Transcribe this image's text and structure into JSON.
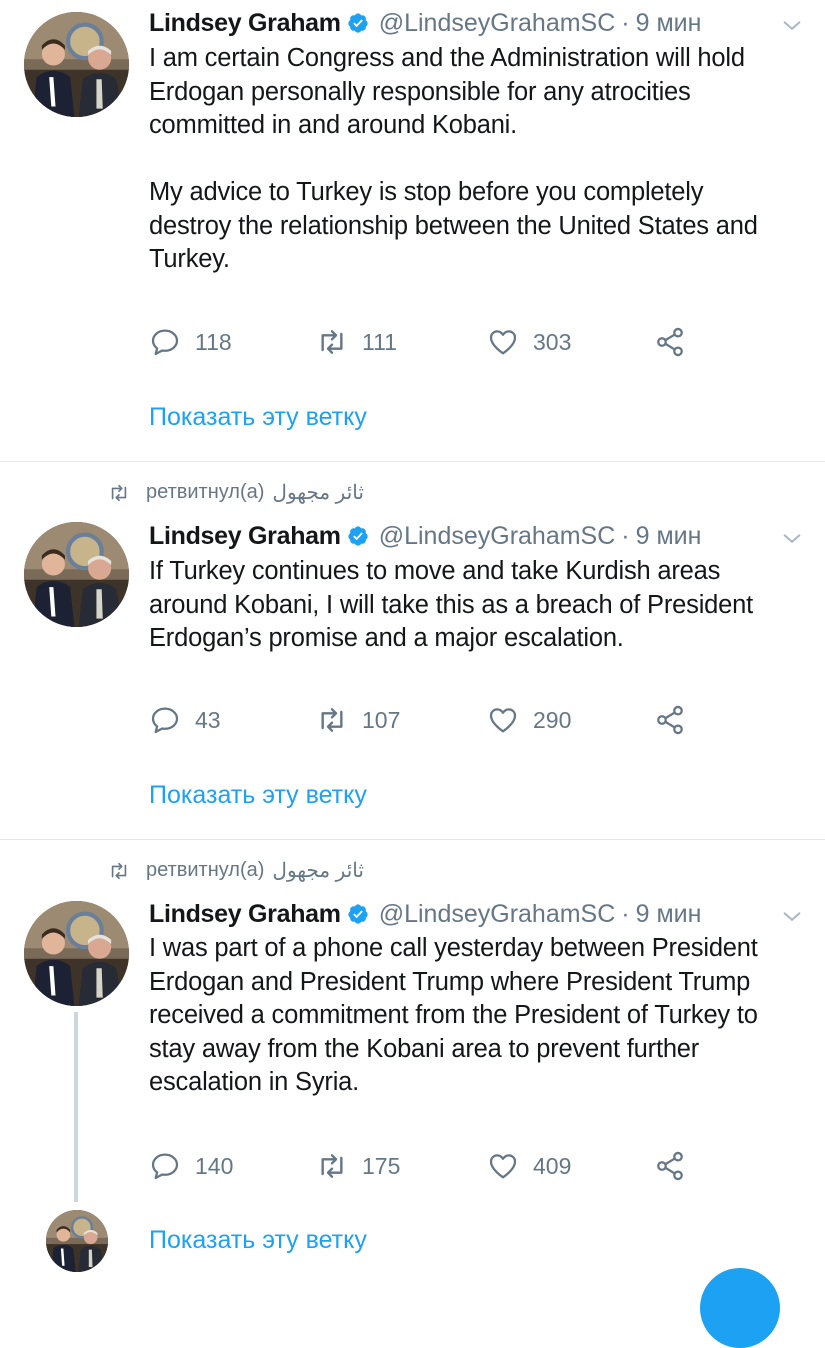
{
  "tweets": [
    {
      "name": "Lindsey Graham",
      "handle": "@LindseyGrahamSC",
      "dot": "·",
      "time": "9 мин",
      "text": "I am certain Congress and the Administration will hold\nErdogan personally responsible for any atrocities\ncommitted in and around Kobani.\n\nMy advice to Turkey is stop before you completely\ndestroy the relationship between the United States and\nTurkey.",
      "replies": "118",
      "retweets": "111",
      "likes": "303",
      "show_thread": "Показать эту ветку"
    },
    {
      "retweeted_by": "ثائر مجهول",
      "retweeted_label": "ретвитнул(а)",
      "name": "Lindsey Graham",
      "handle": "@LindseyGrahamSC",
      "dot": "·",
      "time": "9 мин",
      "text": "If Turkey continues to move and take Kurdish areas\naround Kobani, I will take this as a breach of President\nErdogan’s promise and a major escalation.",
      "replies": "43",
      "retweets": "107",
      "likes": "290",
      "show_thread": "Показать эту ветку"
    },
    {
      "retweeted_by": "ثائر مجهول",
      "retweeted_label": "ретвитнул(а)",
      "name": "Lindsey Graham",
      "handle": "@LindseyGrahamSC",
      "dot": "·",
      "time": "9 мин",
      "text": "I was part of a phone call yesterday between President\nErdogan and President Trump where President Trump\nreceived a commitment from the President of Turkey to\nstay away from the Kobani area to prevent further\nescalation in Syria.",
      "replies": "140",
      "retweets": "175",
      "likes": "409",
      "show_thread": "Показать эту ветку"
    }
  ],
  "icons": {
    "reply": "reply-icon",
    "retweet": "retweet-icon",
    "like": "heart-icon",
    "share": "share-icon",
    "verified": "verified-badge-icon",
    "caret": "chevron-down-icon"
  },
  "colors": {
    "accent": "#1da1f2",
    "muted": "#657786",
    "text": "#14171a",
    "divider": "#e1e8ed"
  }
}
